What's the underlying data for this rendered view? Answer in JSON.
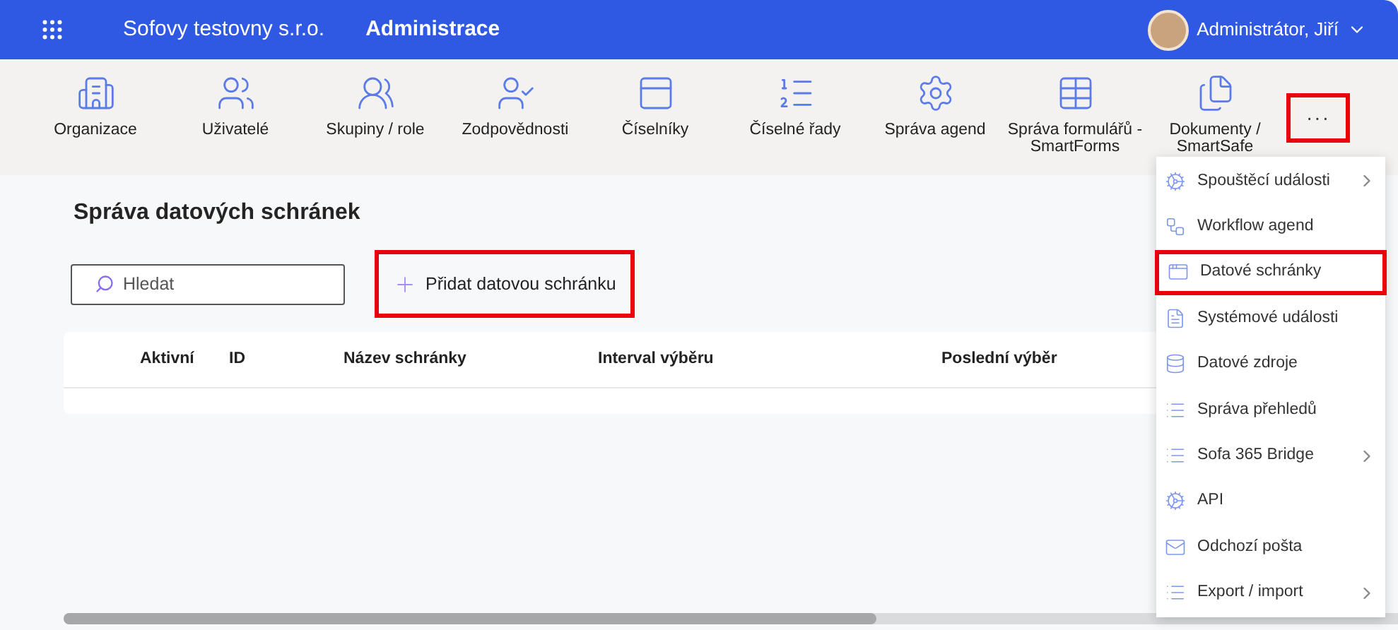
{
  "header": {
    "company": "Sofovy testovny s.r.o.",
    "section": "Administrace",
    "user": "Administrátor, Jiří"
  },
  "toolbar": {
    "items": [
      {
        "label": "Organizace"
      },
      {
        "label": "Uživatelé"
      },
      {
        "label": "Skupiny / role"
      },
      {
        "label": "Zodpovědnosti"
      },
      {
        "label": "Číselníky"
      },
      {
        "label": "Číselné řady"
      },
      {
        "label": "Správa agend"
      },
      {
        "label": "Správa formulářů - SmartForms"
      },
      {
        "label": "Dokumenty / SmartSafe"
      }
    ],
    "more": {
      "label": "···",
      "highlighted": true
    }
  },
  "page": {
    "title": "Správa datových schránek",
    "search": {
      "placeholder": "Hledat"
    },
    "add_button": {
      "label": "Přidat datovou schránku",
      "highlighted": true
    }
  },
  "table": {
    "columns": [
      "Aktivní",
      "ID",
      "Název schránky",
      "Interval výběru",
      "Poslední výběr"
    ]
  },
  "menu": {
    "items": [
      {
        "label": "Spouštěcí události",
        "has_submenu": true,
        "highlighted": false
      },
      {
        "label": "Workflow agend",
        "has_submenu": false,
        "highlighted": false
      },
      {
        "label": "Datové schránky",
        "has_submenu": false,
        "highlighted": true
      },
      {
        "label": "Systémové události",
        "has_submenu": false,
        "highlighted": false
      },
      {
        "label": "Datové zdroje",
        "has_submenu": false,
        "highlighted": false
      },
      {
        "label": "Správa přehledů",
        "has_submenu": false,
        "highlighted": false
      },
      {
        "label": "Sofa 365 Bridge",
        "has_submenu": true,
        "highlighted": false
      },
      {
        "label": "API",
        "has_submenu": false,
        "highlighted": false
      },
      {
        "label": "Odchozí pošta",
        "has_submenu": false,
        "highlighted": false
      },
      {
        "label": "Export / import",
        "has_submenu": true,
        "highlighted": false
      }
    ]
  }
}
